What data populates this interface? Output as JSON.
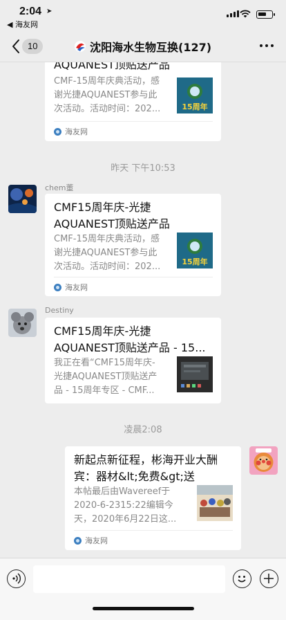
{
  "status_bar": {
    "time": "2:04",
    "back_app": "◀ 海友网"
  },
  "nav": {
    "unread_count": "10",
    "title": "沈阳海水生物互换(127)"
  },
  "messages": [
    {
      "title": "AQUANEST顶贴送产品",
      "desc": [
        "CMF-15周年庆典活动，感",
        "谢光捷AQUANEST参与此",
        "次活动。活动时间：202..."
      ],
      "source": "海友网",
      "thumb_text": "15周年"
    },
    {
      "timestamp": "昨天 下午10:53"
    },
    {
      "sender": "chem董",
      "title": [
        "CMF15周年庆-光捷",
        "AQUANEST顶贴送产品"
      ],
      "desc": [
        "CMF-15周年庆典活动，感",
        "谢光捷AQUANEST参与此",
        "次活动。活动时间：202..."
      ],
      "source": "海友网",
      "thumb_text": "15周年"
    },
    {
      "sender": "Destiny",
      "title": [
        "CMF15周年庆-光捷",
        "AQUANEST顶贴送产品 - 15..."
      ],
      "desc": [
        "我正在看“CMF15周年庆-",
        "光捷AQUANEST顶贴送产",
        "品 - 15周年专区 - CMF..."
      ]
    },
    {
      "timestamp": "凌晨2:08"
    },
    {
      "title": [
        "新起点新征程，彬海开业大酬",
        "宾：器材&lt;免费&gt;送"
      ],
      "desc": [
        "本帖最后由Wavereef于",
        "2020-6-2315:22编辑今",
        "天，2020年6月22日这..."
      ],
      "source": "海友网"
    }
  ],
  "colors": {
    "background": "#ededed",
    "card": "#ffffff",
    "accent": "#3c7fc0"
  },
  "input_bar": {
    "icons": [
      "voice-icon",
      "emoji-icon",
      "plus-icon"
    ]
  }
}
